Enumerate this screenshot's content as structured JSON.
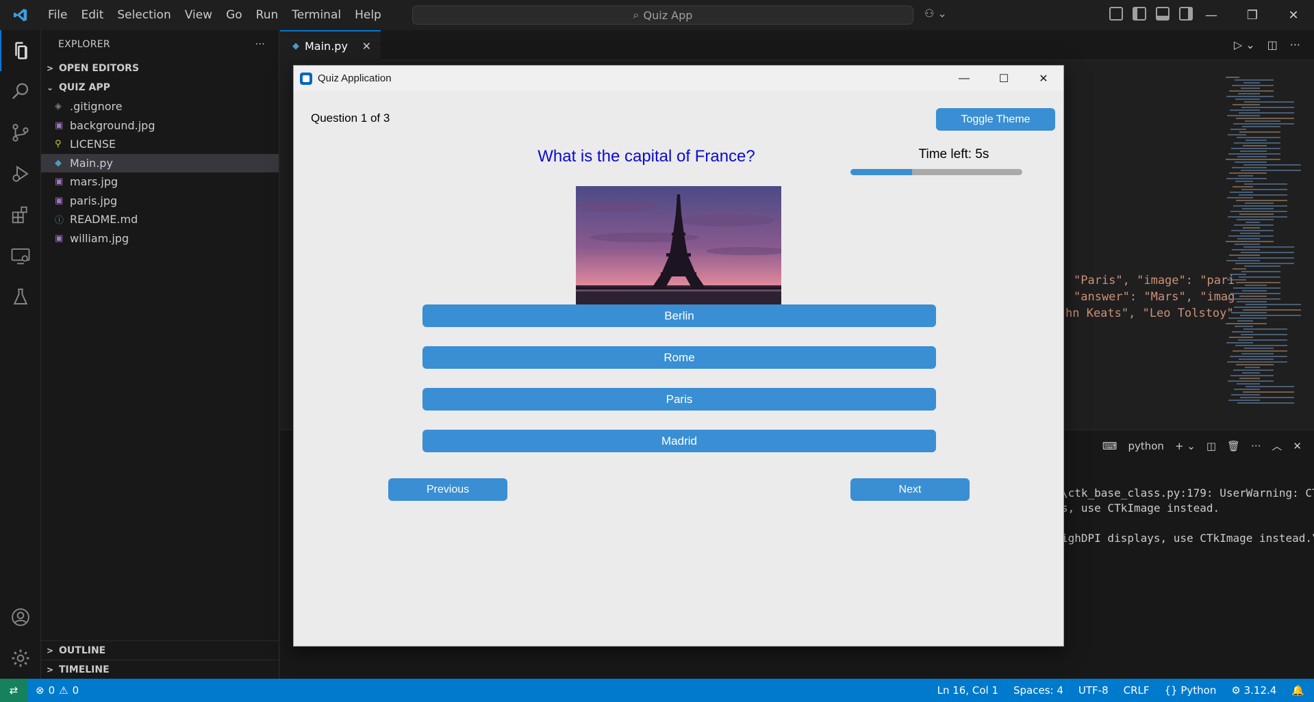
{
  "menu": [
    "File",
    "Edit",
    "Selection",
    "View",
    "Go",
    "Run",
    "Terminal",
    "Help"
  ],
  "command_center": "Quiz App",
  "explorer": {
    "title": "EXPLORER",
    "open_editors": "OPEN EDITORS",
    "folder": "QUIZ APP",
    "files": [
      {
        "name": ".gitignore",
        "icon": "gear-file-icon",
        "color": "#6d8086"
      },
      {
        "name": "background.jpg",
        "icon": "image-file-icon",
        "color": "#a074c4"
      },
      {
        "name": "LICENSE",
        "icon": "license-file-icon",
        "color": "#cbcb41"
      },
      {
        "name": "Main.py",
        "icon": "python-file-icon",
        "color": "#519aba"
      },
      {
        "name": "mars.jpg",
        "icon": "image-file-icon",
        "color": "#a074c4"
      },
      {
        "name": "paris.jpg",
        "icon": "image-file-icon",
        "color": "#a074c4"
      },
      {
        "name": "README.md",
        "icon": "info-file-icon",
        "color": "#519aba"
      },
      {
        "name": "william.jpg",
        "icon": "image-file-icon",
        "color": "#a074c4"
      }
    ],
    "outline": "OUTLINE",
    "timeline": "TIMELINE"
  },
  "tab": {
    "label": "Main.py"
  },
  "code_fragments": [
    "\"Paris\", \"image\": \"pari",
    "\"answer\": \"Mars\", \"imag",
    "hn Keats\", \"Leo Tolstoy\""
  ],
  "terminal": {
    "shell": "python",
    "lines": [
      "\\ctk_base_class.py:179: UserWarning: CT",
      "s, use CTkImage instead.",
      "ighDPI displays, use CTkImage instead.\\"
    ]
  },
  "status": {
    "errors": "0",
    "warnings": "0",
    "position": "Ln 16, Col 1",
    "spaces": "Spaces: 4",
    "encoding": "UTF-8",
    "eol": "CRLF",
    "language": "Python",
    "version": "3.12.4"
  },
  "quiz": {
    "window_title": "Quiz Application",
    "question_counter": "Question 1 of 3",
    "toggle_theme": "Toggle Theme",
    "question": "What is the capital of France?",
    "timer": "Time left: 5s",
    "progress_fraction": 0.36,
    "answers": [
      "Berlin",
      "Rome",
      "Paris",
      "Madrid"
    ],
    "previous": "Previous",
    "next": "Next",
    "accent": "#3a8ed3",
    "question_color": "#0a0ad2"
  }
}
